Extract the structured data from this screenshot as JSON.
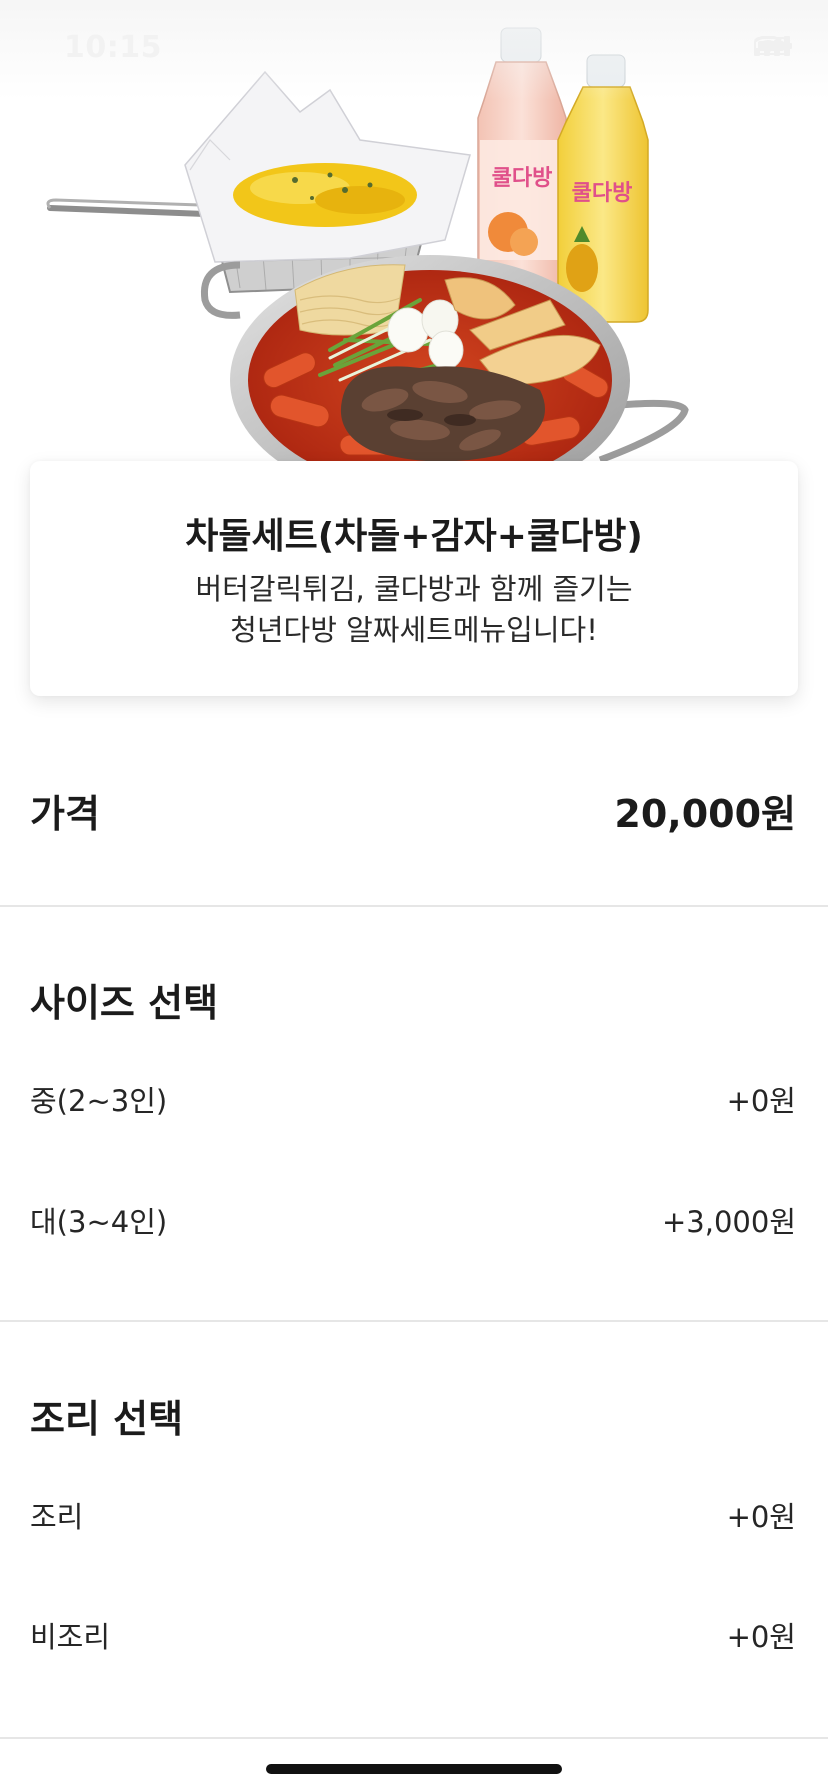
{
  "status_bar": {
    "time": "10:15"
  },
  "hero": {
    "image_alt": "차돌 떡볶이, 버터갈릭 감자튀김, 쿨다방 음료 세트 사진"
  },
  "product": {
    "name": "차돌세트(차돌+감자+쿨다방)",
    "description_line1": "버터갈릭튀김, 쿨다방과 함께 즐기는",
    "description_line2": "청년다방 알짜세트메뉴입니다!"
  },
  "price": {
    "label": "가격",
    "value": "20,000원"
  },
  "size_section": {
    "title": "사이즈 선택",
    "options": [
      {
        "label": "중(2~3인)",
        "price": "+0원"
      },
      {
        "label": "대(3~4인)",
        "price": "+3,000원"
      }
    ]
  },
  "cook_section": {
    "title": "조리 선택",
    "options": [
      {
        "label": "조리",
        "price": "+0원"
      },
      {
        "label": "비조리",
        "price": "+0원"
      }
    ]
  }
}
